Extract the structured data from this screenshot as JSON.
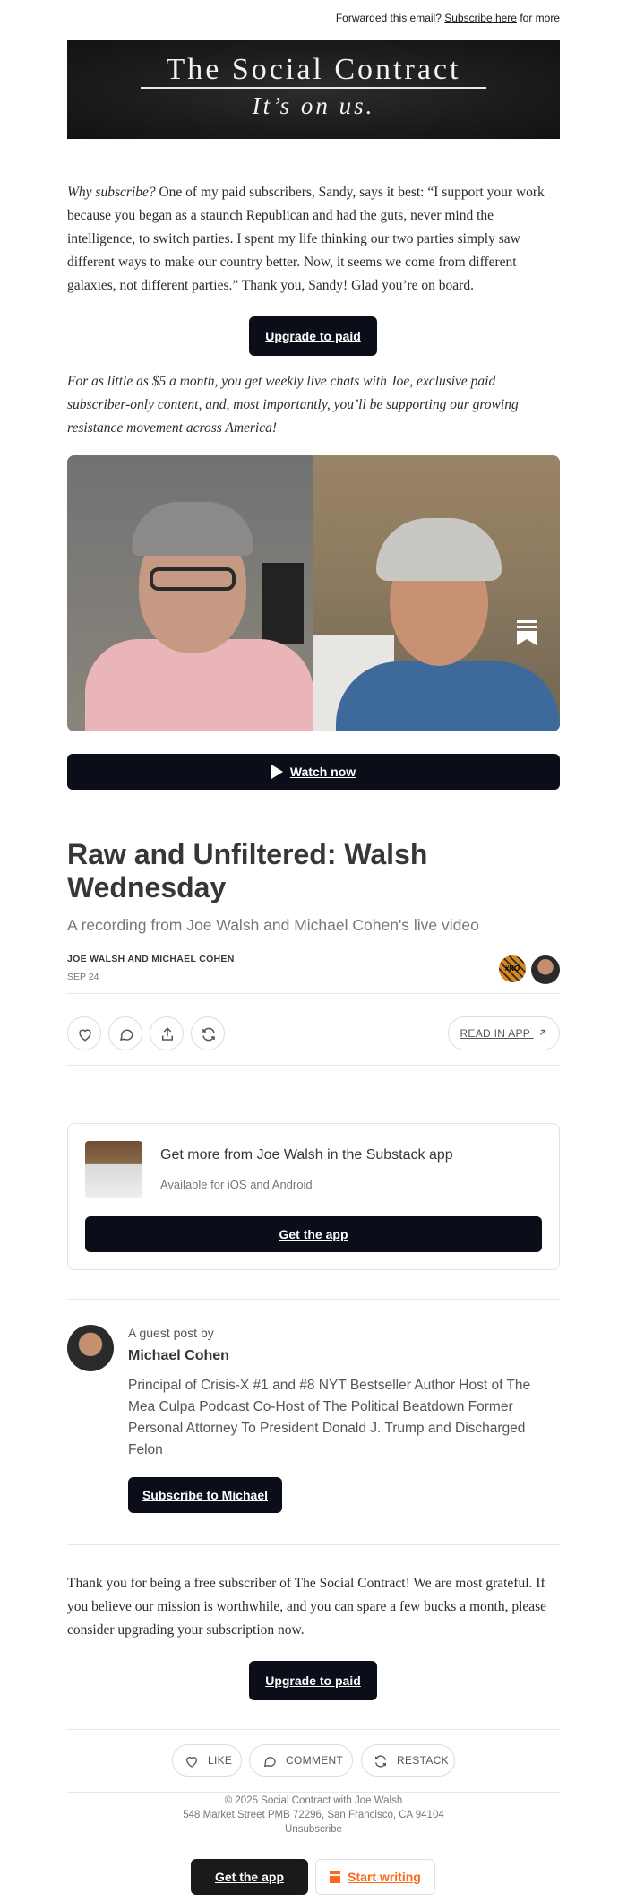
{
  "header": {
    "forwarded_prefix": "Forwarded this email?",
    "subscribe_link": "Subscribe here",
    "forwarded_suffix": "for more"
  },
  "banner": {
    "title": "The Social Contract",
    "tagline": "It’s on us."
  },
  "intro": {
    "lead_italic": "Why subscribe?",
    "text": " One of my paid subscribers, Sandy, says it best: “I support your work because you began as a staunch Republican and had the guts, never mind the intelligence, to switch parties. I spent my life thinking our two parties simply saw different ways to make our country better. Now, it seems we come from different galaxies, not different parties.” Thank you, Sandy! Glad you’re on board.",
    "upgrade_button": "Upgrade to paid",
    "pitch": "For as little as $5 a month, you get weekly live chats with Joe, exclusive paid subscriber-only content, and, most importantly, you’ll be supporting our growing resistance movement across America!"
  },
  "video": {
    "watch_label": "Watch now"
  },
  "post": {
    "title": "Raw and Unfiltered: Walsh Wednesday",
    "subtitle": "A recording from Joe Walsh and Michael Cohen's live video",
    "authors": "JOE WALSH AND MICHAEL COHEN",
    "date": "SEP 24",
    "avatar_badge": "#NO KINGS",
    "read_in_app": "READ IN APP"
  },
  "app_promo": {
    "heading": "Get more from Joe Walsh in the Substack app",
    "subheading": "Available for iOS and Android",
    "button": "Get the app"
  },
  "guest": {
    "label": "A guest post by",
    "name": "Michael Cohen",
    "bio": "Principal of Crisis-X #1 and #8 NYT Bestseller Author Host of The Mea Culpa Podcast Co-Host of The Political Beatdown Former Personal Attorney To President Donald J. Trump and Discharged Felon",
    "subscribe_button": "Subscribe to Michael"
  },
  "closing": {
    "text": "Thank you for being a free subscriber of The Social Contract! We are most grateful. If you believe our mission is worthwhile, and you can spare a few bucks a month, please consider upgrading your subscription now.",
    "upgrade_button": "Upgrade to paid"
  },
  "actions": {
    "like": "LIKE",
    "comment": "COMMENT",
    "restack": "RESTACK"
  },
  "footer": {
    "copyright": "© 2025 Social Contract with Joe Walsh",
    "address": "548 Market Street PMB 72296, San Francisco, CA 94104",
    "unsubscribe": "Unsubscribe",
    "get_app": "Get the app",
    "start_writing": "Start writing"
  },
  "colors": {
    "dark_button": "#0b0d19",
    "text": "#363737",
    "muted": "#777777",
    "brand_orange": "#ff6719"
  }
}
